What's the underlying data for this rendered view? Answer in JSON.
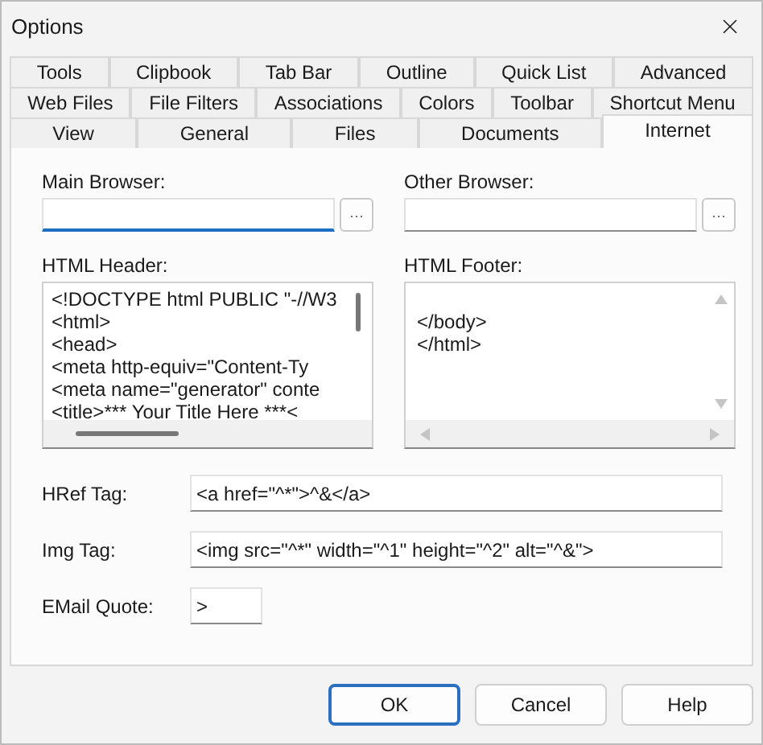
{
  "window": {
    "title": "Options"
  },
  "tab_rows": [
    [
      {
        "label": "Tools",
        "selected": false
      },
      {
        "label": "Clipbook",
        "selected": false
      },
      {
        "label": "Tab Bar",
        "selected": false
      },
      {
        "label": "Outline",
        "selected": false
      },
      {
        "label": "Quick List",
        "selected": false
      },
      {
        "label": "Advanced",
        "selected": false
      }
    ],
    [
      {
        "label": "Web Files",
        "selected": false
      },
      {
        "label": "File Filters",
        "selected": false
      },
      {
        "label": "Associations",
        "selected": false
      },
      {
        "label": "Colors",
        "selected": false
      },
      {
        "label": "Toolbar",
        "selected": false
      },
      {
        "label": "Shortcut Menu",
        "selected": false
      }
    ],
    [
      {
        "label": "View",
        "selected": false
      },
      {
        "label": "General",
        "selected": false
      },
      {
        "label": "Files",
        "selected": false
      },
      {
        "label": "Documents",
        "selected": false
      },
      {
        "label": "Internet",
        "selected": true
      }
    ]
  ],
  "browsers": [
    {
      "label": "Main Browser:",
      "focused": true,
      "browse": "···"
    },
    {
      "label": "Other Browser:",
      "focused": false,
      "browse": "···"
    }
  ],
  "html_header": {
    "label": "HTML Header:",
    "lines": [
      "<!DOCTYPE html PUBLIC \"-//W3",
      "<html>",
      "<head>",
      "<meta http-equiv=\"Content-Ty",
      "<meta name=\"generator\" conte",
      "<title>*** Your Title Here ***<"
    ]
  },
  "html_footer": {
    "label": "HTML Footer:",
    "lines": [
      "</body>",
      "</html>"
    ]
  },
  "tag_fields": [
    {
      "label": "HRef Tag:",
      "value": "<a href=\"^*\">^&</a>"
    },
    {
      "label": "Img Tag:",
      "value": "<img src=\"^*\" width=\"^1\" height=\"^2\" alt=\"^&\">"
    }
  ],
  "email_quote": {
    "label": "EMail Quote:",
    "value": ">"
  },
  "buttons": [
    {
      "label": "OK",
      "default": true
    },
    {
      "label": "Cancel",
      "default": false
    },
    {
      "label": "Help",
      "default": false
    }
  ]
}
